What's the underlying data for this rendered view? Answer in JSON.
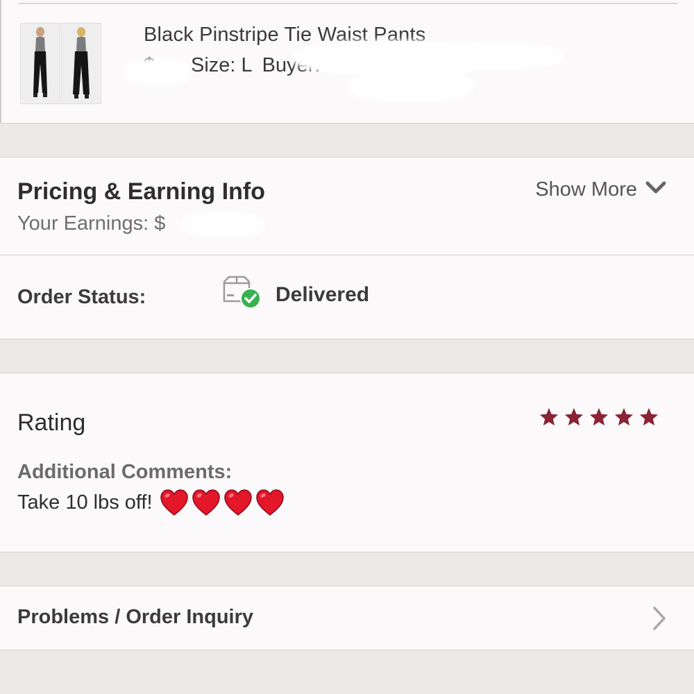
{
  "product": {
    "title": "Black Pinstripe Tie Waist Pants",
    "price_fragment": "$",
    "size_label": "Size: L",
    "buyer_label": "Buyer:",
    "images": [
      "product-photo-front",
      "product-photo-back"
    ]
  },
  "pricing": {
    "title": "Pricing & Earning Info",
    "earnings_label": "Your Earnings: $",
    "show_more_label": "Show More"
  },
  "order_status": {
    "label": "Order Status:",
    "value": "Delivered",
    "icon": "package-delivered-icon",
    "icon_color": "#3bb04f"
  },
  "rating": {
    "title": "Rating",
    "stars": 5,
    "max_stars": 5,
    "star_color": "#8b2337",
    "comments_label": "Additional Comments:",
    "comments_text": "Take 10 lbs off!",
    "comments_emoji_hearts": 4,
    "heart_color": "#e3162a"
  },
  "problems": {
    "label": "Problems / Order Inquiry"
  }
}
